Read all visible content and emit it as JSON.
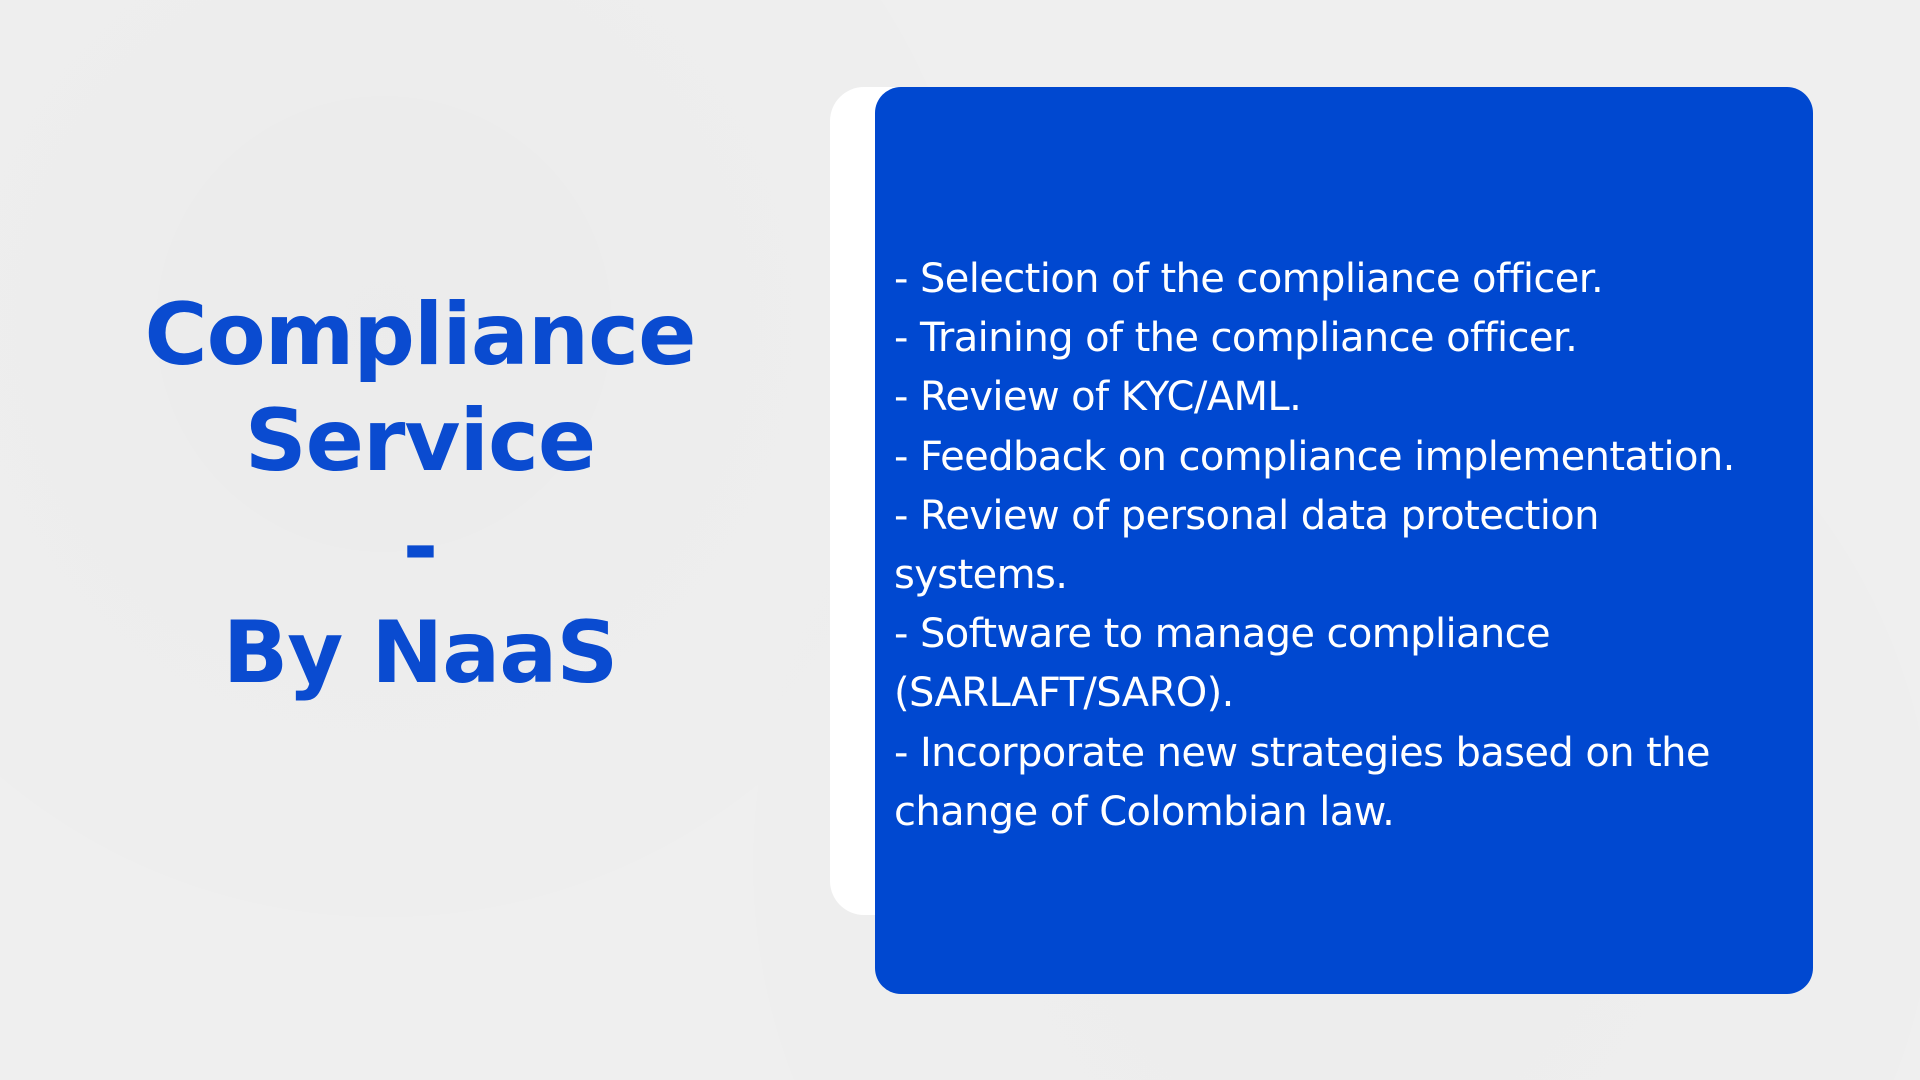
{
  "title": {
    "line1": "Compliance",
    "line2": "Service",
    "line3": "-",
    "line4": "By NaaS"
  },
  "items": [
    "- Selection of the compliance officer.",
    "- Training of the compliance officer.",
    "- Review of KYC/AML.",
    "- Feedback on compliance implementation.",
    "- Review of personal data protection systems.",
    "- Software to manage compliance (SARLAFT/SARO).",
    "- Incorporate new strategies based on the change of Colombian law."
  ],
  "colors": {
    "background": "#efefef",
    "accent": "#0048d0",
    "title_text": "#0a4bd0",
    "card_text": "#ffffff",
    "back_card": "#ffffff"
  }
}
